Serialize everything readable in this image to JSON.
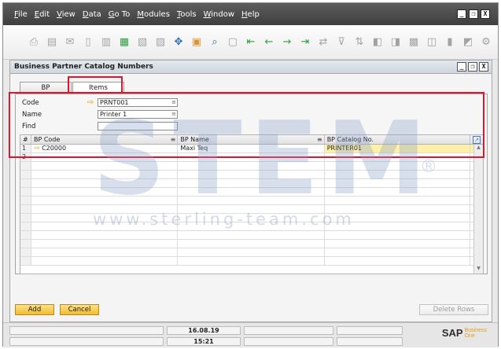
{
  "menu": [
    "File",
    "Edit",
    "View",
    "Data",
    "Go To",
    "Modules",
    "Tools",
    "Window",
    "Help"
  ],
  "window_controls": [
    "_",
    "❐",
    "X"
  ],
  "toolbar_icons": [
    "print-preview-icon",
    "print-icon",
    "email-icon",
    "sms-icon",
    "fax-icon",
    "export-excel-icon",
    "export-word-icon",
    "export-pdf-icon",
    "launch-app-icon",
    "lock-screen-icon",
    "find-icon",
    "add-icon",
    "first-record-icon",
    "previous-record-icon",
    "next-record-icon",
    "last-record-icon",
    "refresh-icon",
    "filter-icon",
    "sort-icon",
    "base-document-icon",
    "target-document-icon",
    "gross-profit-icon",
    "payment-means-icon",
    "volume-weight-icon",
    "layout-designer-icon",
    "form-settings-icon"
  ],
  "form": {
    "title": "Business Partner Catalog Numbers",
    "controls": [
      "_",
      "❐",
      "X"
    ],
    "tabs": [
      {
        "label": "BP",
        "active": false
      },
      {
        "label": "Items",
        "active": true
      }
    ],
    "code_label": "Code",
    "code_value": "PRNT001",
    "name_label": "Name",
    "name_value": "Printer 1",
    "find_label": "Find",
    "find_value": "",
    "grid": {
      "columns": [
        "#",
        "BP Code",
        "BP Name",
        "BP Catalog No."
      ],
      "rows": [
        {
          "num": "1",
          "bp_code": "C20000",
          "bp_name": "Maxi Teq",
          "catalog_no": "PRINTER01"
        },
        {
          "num": "2",
          "bp_code": "",
          "bp_name": "",
          "catalog_no": ""
        }
      ],
      "empty_rows": 12
    },
    "buttons": {
      "add": "Add",
      "cancel": "Cancel",
      "delete_rows": "Delete Rows"
    }
  },
  "statusbar": {
    "date": "16.08.19",
    "time": "15:21",
    "logo_main": "SAP",
    "logo_sub_1": "Business",
    "logo_sub_2": "One"
  },
  "watermark": {
    "brand": "STEM",
    "url": "www.sterling-team.com",
    "reg": "®"
  },
  "colors": {
    "highlight_red": "#e0142a",
    "button_gold": "#f2bb2a",
    "menubar": "#4a4a4a",
    "catalog_highlight": "#fff0a8"
  }
}
